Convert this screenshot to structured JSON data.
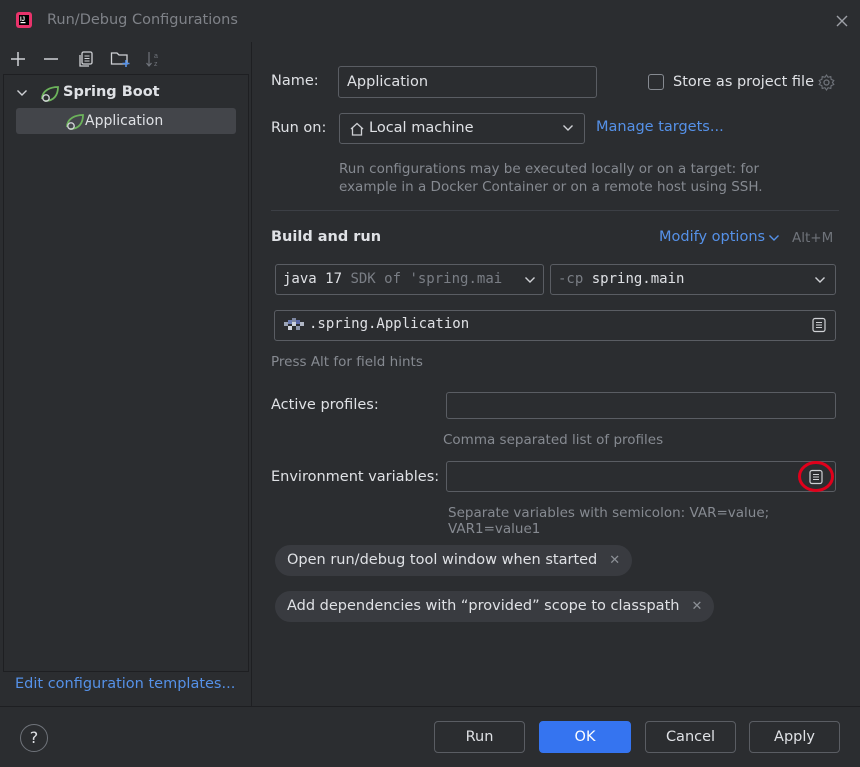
{
  "window": {
    "title": "Run/Debug Configurations"
  },
  "toolbar": {
    "icons": [
      "add-icon",
      "remove-icon",
      "copy-icon",
      "new-folder-icon",
      "sort-icon"
    ]
  },
  "tree": {
    "group_label": "Spring Boot",
    "item_label": "Application"
  },
  "left": {
    "edit_templates": "Edit configuration templates..."
  },
  "form": {
    "name_label": "Name:",
    "name_value": "Application",
    "store_label": "Store as project file",
    "store_checked": false,
    "runon_label": "Run on:",
    "runon_value": "Local machine",
    "manage_targets": "Manage targets...",
    "runon_hint_line1": "Run configurations may be executed locally or on a target: for",
    "runon_hint_line2": "example in a Docker Container or on a remote host using SSH.",
    "build_title": "Build and run",
    "modify_options": "Modify options",
    "modify_shortcut": "Alt+M",
    "sdk_main": "java 17",
    "sdk_hint": "SDK of 'spring.mai",
    "cp_flag": "-cp",
    "cp_value": "spring.main",
    "main_class": ".spring.Application",
    "field_hints": "Press Alt for field hints",
    "profiles_label": "Active profiles:",
    "profiles_value": "",
    "profiles_hint": "Comma separated list of profiles",
    "env_label": "Environment variables:",
    "env_value": "",
    "env_hint": "Separate variables with semicolon: VAR=value; VAR1=value1"
  },
  "chips": [
    {
      "label": "Open run/debug tool window when started",
      "remove": "✕"
    },
    {
      "label": "Add dependencies with “provided” scope to classpath",
      "remove": "✕"
    }
  ],
  "buttons": {
    "help": "?",
    "run": "Run",
    "ok": "OK",
    "cancel": "Cancel",
    "apply": "Apply"
  },
  "colors": {
    "background": "#2b2d30",
    "accent": "#3574f0",
    "link": "#5591e8",
    "highlight_circle": "#e0001b"
  }
}
